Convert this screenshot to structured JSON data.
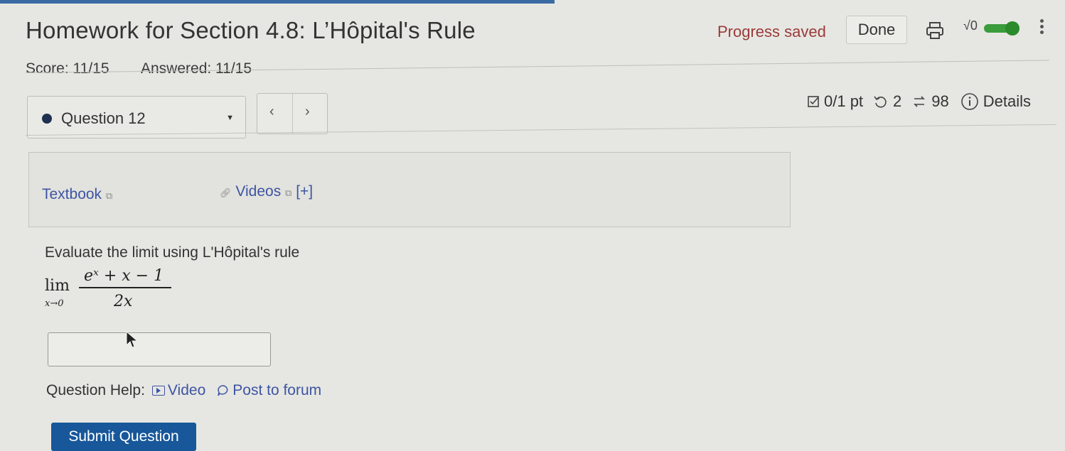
{
  "header": {
    "title": "Homework for Section 4.8: L’Hôpital's Rule",
    "progress_status": "Progress saved",
    "done_label": "Done",
    "math_toggle_label": "√0",
    "accent_color": "#3a6aa4"
  },
  "summary": {
    "score": "Score: 11/15",
    "answered": "Answered: 11/15"
  },
  "question_nav": {
    "selected_question": "Question 12",
    "prev_symbol": "‹",
    "next_symbol": "›"
  },
  "question_meta": {
    "points": "0/1 pt",
    "retries": "2",
    "attempts": "98",
    "details_label": "Details"
  },
  "resources": {
    "textbook_label": "Textbook",
    "videos_label": "Videos",
    "videos_expand": "[+]"
  },
  "question": {
    "prompt": "Evaluate the limit using L'Hôpital's rule",
    "lim_word": "lim",
    "lim_subscript": "x→0",
    "numerator": "eˣ + x − 1",
    "denominator": "2x",
    "answer_value": ""
  },
  "help": {
    "label": "Question Help:",
    "video_label": "Video",
    "forum_label": "Post to forum"
  },
  "submit_label": "Submit Question",
  "icons": [
    "print-icon",
    "sqrt-icon",
    "kebab-menu-icon",
    "checkbox-icon",
    "retry-icon",
    "attempts-icon",
    "info-icon",
    "external-link-icon",
    "link-icon",
    "video-icon",
    "comment-icon",
    "cursor-icon",
    "caret-down-icon"
  ],
  "colors": {
    "link": "#3e54a3",
    "progress_text": "#9c3a3a",
    "submit_bg": "#17579a",
    "toggle_on": "#3b9c3b"
  }
}
